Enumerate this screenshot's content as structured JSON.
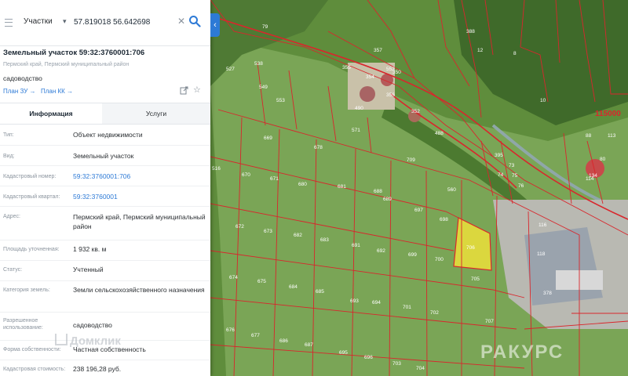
{
  "search": {
    "type_label": "Участки",
    "query": "57.819018 56.642698"
  },
  "parcel": {
    "title": "Земельный участок 59:32:3760001:706",
    "region": "Пермский край, Пермский муниципальный район",
    "usage": "садоводство",
    "plan_zu": "План ЗУ →",
    "plan_kk": "План КК →"
  },
  "tabs": {
    "info": "Информация",
    "services": "Услуги"
  },
  "rows": [
    {
      "label": "Тип:",
      "value": "Объект недвижимости"
    },
    {
      "label": "Вид:",
      "value": "Земельный участок"
    },
    {
      "label": "Кадастровый номер:",
      "value": "59:32:3760001:706"
    },
    {
      "label": "Кадастровый квартал:",
      "value": "59:32:3760001"
    },
    {
      "label": "Адрес:",
      "value": "Пермский край, Пермский муниципальный район"
    },
    {
      "label": "Площадь уточненная:",
      "value": "1 932 кв. м"
    },
    {
      "label": "Статус:",
      "value": "Учтенный"
    },
    {
      "label": "Категория земель:",
      "value": "Земли сельскохозяйственного назначения"
    },
    {
      "label": "Разрешенное использование:",
      "value": "садоводство"
    },
    {
      "label": "Форма собственности:",
      "value": "Частная собственность"
    },
    {
      "label": "Кадастровая стоимость:",
      "value": "238 196,28 руб."
    }
  ],
  "watermarks": {
    "left": "Домклик",
    "right": "РАКУРС"
  },
  "map": {
    "block_label": "115000",
    "selected_parcel": "706",
    "selected_color": "#ecdf3a",
    "boundary_color": "#d9262c",
    "parcels_field": [
      "669",
      "678",
      "670",
      "671",
      "680",
      "681",
      "688",
      "689",
      "672",
      "673",
      "682",
      "683",
      "691",
      "692",
      "674",
      "675",
      "684",
      "685",
      "693",
      "694",
      "676",
      "677",
      "686",
      "687",
      "695",
      "696",
      "697",
      "698",
      "699",
      "700",
      "701",
      "702",
      "703",
      "704",
      "705",
      "707",
      "709",
      "560",
      "571",
      "488",
      "552",
      "553",
      "549",
      "538",
      "527",
      "516",
      "361"
    ],
    "parcels_village": [
      "357",
      "355",
      "354",
      "356",
      "352",
      "350",
      "490",
      "79",
      "388",
      "12",
      "8",
      "10",
      "395",
      "74",
      "73",
      "75",
      "76",
      "116",
      "118",
      "378",
      "134",
      "88",
      "80",
      "113",
      "114",
      "80"
    ]
  }
}
